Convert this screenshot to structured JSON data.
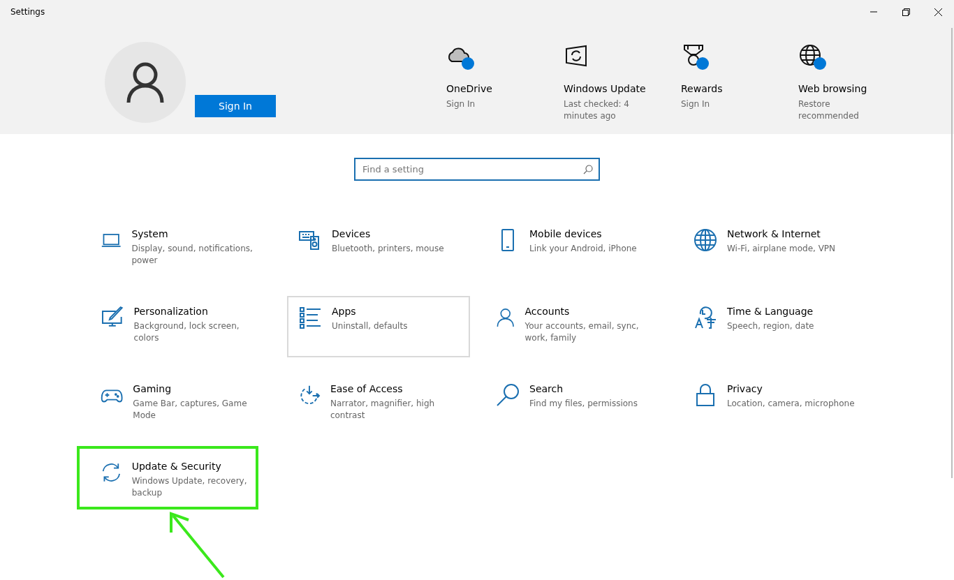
{
  "window": {
    "title": "Settings"
  },
  "account": {
    "button": "Sign In"
  },
  "quick_links": [
    {
      "title": "OneDrive",
      "subtitle": "Sign In",
      "badge": true
    },
    {
      "title": "Windows Update",
      "subtitle": "Last checked: 4 minutes ago",
      "badge": false
    },
    {
      "title": "Rewards",
      "subtitle": "Sign In",
      "badge": true
    },
    {
      "title": "Web browsing",
      "subtitle": "Restore recommended",
      "badge": true
    }
  ],
  "search": {
    "placeholder": "Find a setting"
  },
  "categories": [
    {
      "title": "System",
      "subtitle": "Display, sound, notifications, power",
      "hovered": false,
      "annotated": false
    },
    {
      "title": "Devices",
      "subtitle": "Bluetooth, printers, mouse",
      "hovered": false,
      "annotated": false
    },
    {
      "title": "Mobile devices",
      "subtitle": "Link your Android, iPhone",
      "hovered": false,
      "annotated": false
    },
    {
      "title": "Network & Internet",
      "subtitle": "Wi-Fi, airplane mode, VPN",
      "hovered": false,
      "annotated": false
    },
    {
      "title": "Personalization",
      "subtitle": "Background, lock screen, colors",
      "hovered": false,
      "annotated": false
    },
    {
      "title": "Apps",
      "subtitle": "Uninstall, defaults",
      "hovered": true,
      "annotated": false
    },
    {
      "title": "Accounts",
      "subtitle": "Your accounts, email, sync, work, family",
      "hovered": false,
      "annotated": false
    },
    {
      "title": "Time & Language",
      "subtitle": "Speech, region, date",
      "hovered": false,
      "annotated": false
    },
    {
      "title": "Gaming",
      "subtitle": "Game Bar, captures, Game Mode",
      "hovered": false,
      "annotated": false
    },
    {
      "title": "Ease of Access",
      "subtitle": "Narrator, magnifier, high contrast",
      "hovered": false,
      "annotated": false
    },
    {
      "title": "Search",
      "subtitle": "Find my files, permissions",
      "hovered": false,
      "annotated": false
    },
    {
      "title": "Privacy",
      "subtitle": "Location, camera, microphone",
      "hovered": false,
      "annotated": false
    },
    {
      "title": "Update & Security",
      "subtitle": "Windows Update, recovery, backup",
      "hovered": false,
      "annotated": true
    }
  ]
}
